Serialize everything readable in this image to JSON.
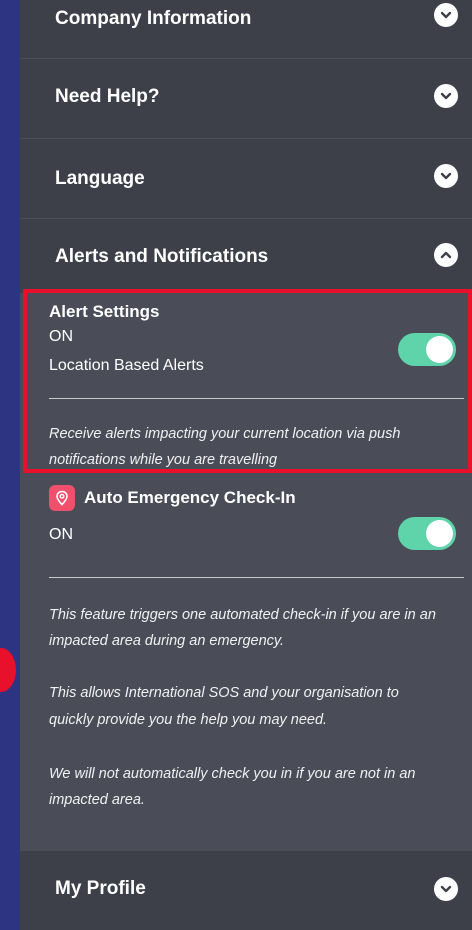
{
  "sections": {
    "company": {
      "title": "Company Information"
    },
    "help": {
      "title": "Need Help?"
    },
    "language": {
      "title": "Language"
    },
    "alerts": {
      "title": "Alerts and Notifications"
    },
    "profile": {
      "title": "My Profile"
    }
  },
  "alert_settings": {
    "heading": "Alert Settings",
    "status": "ON",
    "label": "Location Based Alerts",
    "description_line1": "Receive alerts impacting your current location via push",
    "description_line2": "notifications while you are travelling"
  },
  "auto_checkin": {
    "heading": "Auto Emergency Check-In",
    "status": "ON",
    "para1_line1": "This feature triggers one automated check-in if you are in an",
    "para1_line2": "impacted area during an emergency.",
    "para2_line1": "This allows International SOS and your organisation to",
    "para2_line2": "quickly provide you the help you may need.",
    "para3_line1": "We will not automatically check you in if you are not in an",
    "para3_line2": "impacted area."
  },
  "colors": {
    "background": "#2d3583",
    "panel": "#4a4d57",
    "header": "#3d4049",
    "toggle_on": "#5fd3aa",
    "highlight": "#e8102a",
    "pin_badge": "#f0506c"
  },
  "icons": {
    "chevron_down": "chevron-down-icon",
    "chevron_up": "chevron-up-icon",
    "location_pin": "location-pin-icon"
  }
}
